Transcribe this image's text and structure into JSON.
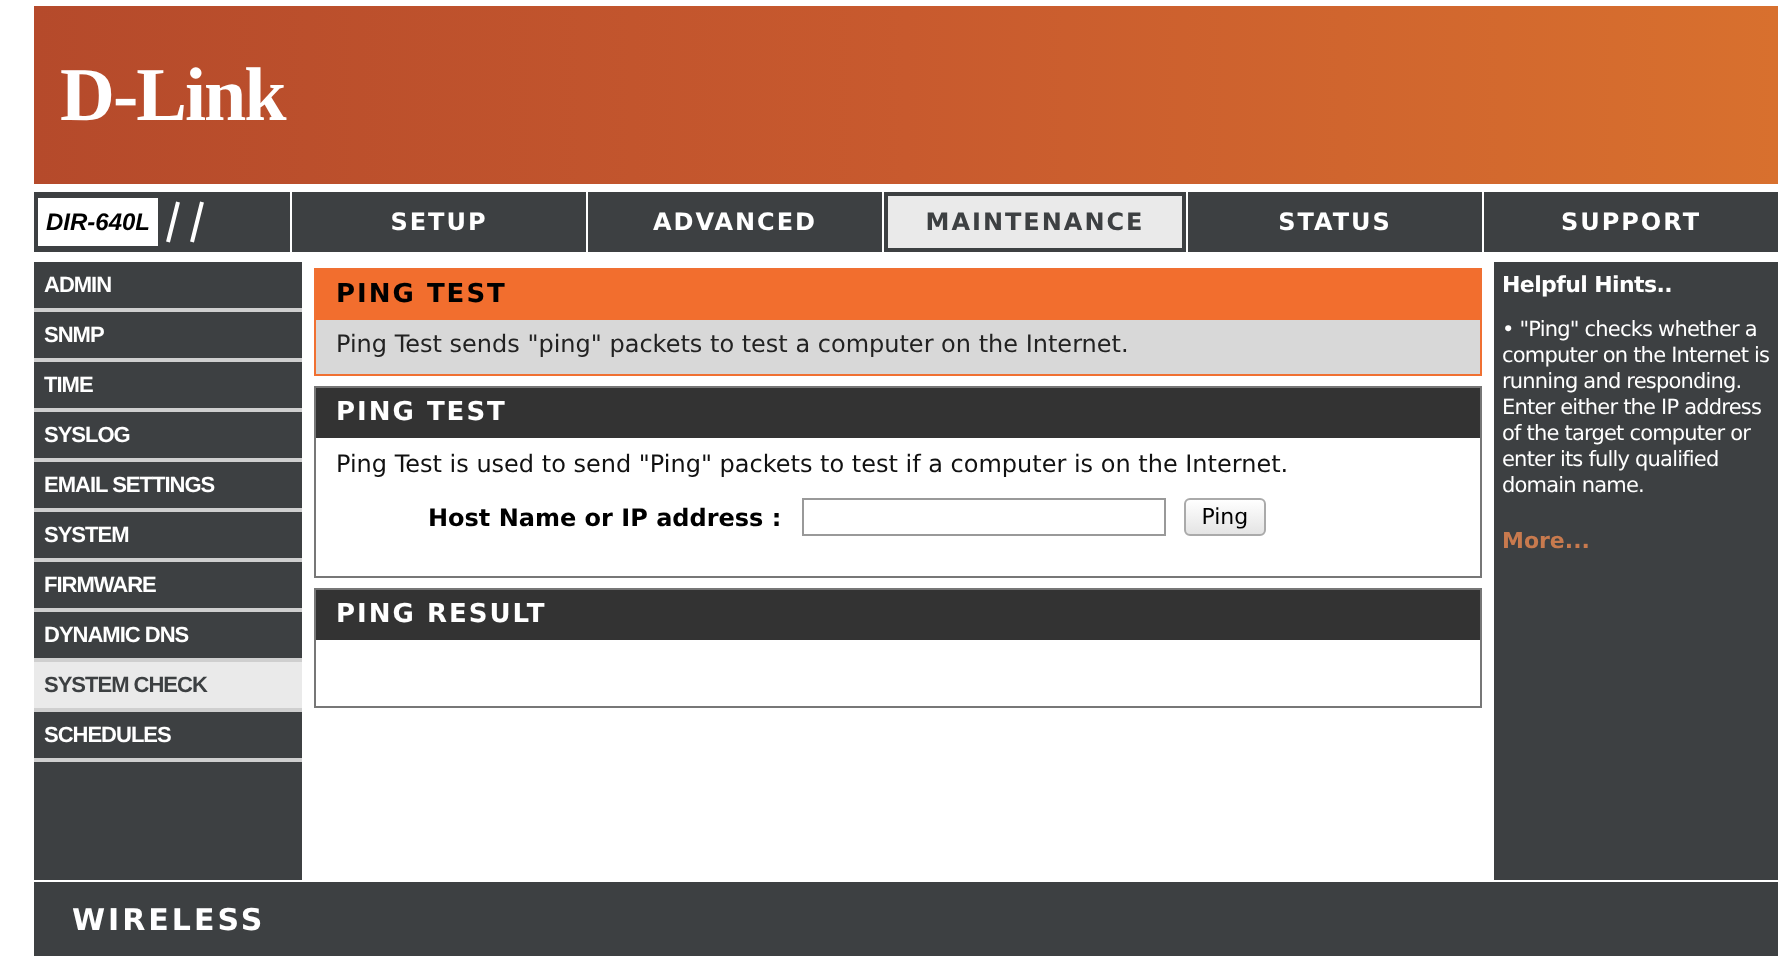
{
  "header": {
    "logo": "D-Link"
  },
  "nav": {
    "model": "DIR-640L",
    "tabs": [
      {
        "label": "SETUP",
        "selected": false
      },
      {
        "label": "ADVANCED",
        "selected": false
      },
      {
        "label": "MAINTENANCE",
        "selected": true
      },
      {
        "label": "STATUS",
        "selected": false
      },
      {
        "label": "SUPPORT",
        "selected": false
      }
    ]
  },
  "sidebar": {
    "items": [
      {
        "label": "ADMIN",
        "selected": false
      },
      {
        "label": "SNMP",
        "selected": false
      },
      {
        "label": "TIME",
        "selected": false
      },
      {
        "label": "SYSLOG",
        "selected": false
      },
      {
        "label": "EMAIL SETTINGS",
        "selected": false
      },
      {
        "label": "SYSTEM",
        "selected": false
      },
      {
        "label": "FIRMWARE",
        "selected": false
      },
      {
        "label": "DYNAMIC DNS",
        "selected": false
      },
      {
        "label": "SYSTEM CHECK",
        "selected": true
      },
      {
        "label": "SCHEDULES",
        "selected": false
      }
    ]
  },
  "intro": {
    "title": "PING TEST",
    "text": "Ping Test sends \"ping\" packets to test a computer on the Internet."
  },
  "ping_test": {
    "title": "PING TEST",
    "text": "Ping Test is used to send \"Ping\" packets to test if a computer is on the Internet.",
    "field_label": "Host Name or IP address :",
    "button": "Ping"
  },
  "ping_result": {
    "title": "PING RESULT"
  },
  "hints": {
    "title": "Helpful Hints..",
    "text": "• \"Ping\" checks whether a computer on the Internet is running and responding. Enter either the IP address of the target computer or enter its fully qualified domain name.",
    "more": "More..."
  },
  "footer": {
    "brand": "WIRELESS"
  }
}
